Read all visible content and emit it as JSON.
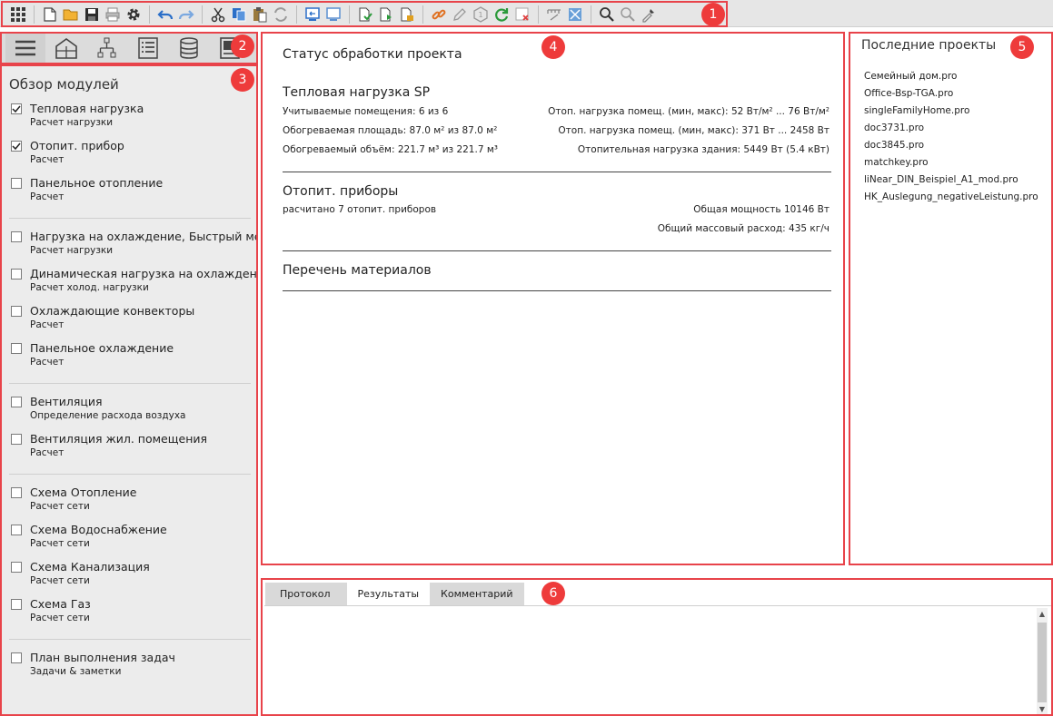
{
  "badges": [
    "1",
    "2",
    "3",
    "4",
    "5",
    "6"
  ],
  "toolbar": {
    "icons": [
      "apps-grid-icon",
      "new-file-icon",
      "open-folder-icon",
      "save-icon",
      "print-icon",
      "settings-gear-icon",
      "undo-icon",
      "redo-icon",
      "cut-icon",
      "copy-icon",
      "paste-icon",
      "replace-icon",
      "import-icon",
      "export-icon",
      "file-check-icon",
      "file-next-icon",
      "file-calc-icon",
      "link-icon",
      "pencil-icon",
      "info-badge-icon",
      "refresh-icon",
      "delete-icon",
      "ruler-icon",
      "fit-view-icon",
      "zoom-icon",
      "zoom-extent-icon",
      "pipette-icon"
    ]
  },
  "left_tabs": [
    "menu-icon",
    "building-icon",
    "network-icon",
    "list-icon",
    "database-icon",
    "report-icon"
  ],
  "modules": {
    "title": "Обзор модулей",
    "groups": [
      [
        {
          "name": "Тепловая нагрузка",
          "sub": "Расчет нагрузки",
          "checked": true
        },
        {
          "name": "Отопит. прибор",
          "sub": "Расчет",
          "checked": true
        },
        {
          "name": "Панельное отопление",
          "sub": "Расчет",
          "checked": false
        }
      ],
      [
        {
          "name": "Нагрузка на охлаждение, Быстрый метод",
          "sub": "Расчет нагрузки",
          "checked": false
        },
        {
          "name": "Динамическая нагрузка на охлаждение",
          "sub": "Расчет холод. нагрузки",
          "checked": false
        },
        {
          "name": "Охлаждающие конвекторы",
          "sub": "Расчет",
          "checked": false
        },
        {
          "name": "Панельное охлаждение",
          "sub": "Расчет",
          "checked": false
        }
      ],
      [
        {
          "name": "Вентиляция",
          "sub": "Определение расхода воздуха",
          "checked": false
        },
        {
          "name": "Вентиляция жил. помещения",
          "sub": "Расчет",
          "checked": false
        }
      ],
      [
        {
          "name": "Схема Отопление",
          "sub": "Расчет сети",
          "checked": false
        },
        {
          "name": "Схема Водоснабжение",
          "sub": "Расчет сети",
          "checked": false
        },
        {
          "name": "Схема Канализация",
          "sub": "Расчет сети",
          "checked": false
        },
        {
          "name": "Схема Газ",
          "sub": "Расчет сети",
          "checked": false
        }
      ],
      [
        {
          "name": "План выполнения задач",
          "sub": "Задачи & заметки",
          "checked": false
        }
      ]
    ]
  },
  "status": {
    "title": "Статус обработки проекта",
    "heat": {
      "title": "Тепловая нагрузка SP",
      "left": [
        "Учитываемые помещения: 6 из 6",
        "Обогреваемая площадь: 87.0 м² из 87.0 м²",
        "Обогреваемый объём: 221.7 м³ из 221.7 м³"
      ],
      "right": [
        "Отоп. нагрузка помещ. (мин, макс): 52 Вт/м² ... 76 Вт/м²",
        "Отоп. нагрузка помещ. (мин, макс): 371 Вт ... 2458 Вт",
        "Отопительная нагрузка здания: 5449 Вт (5.4 кВт)"
      ]
    },
    "radiators": {
      "title": "Отопит. приборы",
      "left": [
        "расчитано 7 отопит. приборов"
      ],
      "right": [
        "Общая мощность 10146 Вт",
        "Общий массовый расход: 435 кг/ч"
      ]
    },
    "materials": {
      "title": "Перечень материалов"
    }
  },
  "recent": {
    "title": "Последние проекты",
    "items": [
      "Семейный дом.pro",
      "Office-Bsp-TGA.pro",
      "singleFamilyHome.pro",
      "doc3731.pro",
      "doc3845.pro",
      "matchkey.pro",
      "liNear_DIN_Beispiel_A1_mod.pro",
      "HK_Auslegung_negativeLeistung.pro"
    ]
  },
  "bottom": {
    "tabs": [
      "Протокол",
      "Результаты",
      "Комментарий"
    ],
    "active_tab": "Результаты"
  },
  "colors": {
    "highlight": "#e8434a",
    "badge": "#ee3b3b",
    "toolbar_bg": "#e6e6e6",
    "panel_bg": "#ececec"
  }
}
